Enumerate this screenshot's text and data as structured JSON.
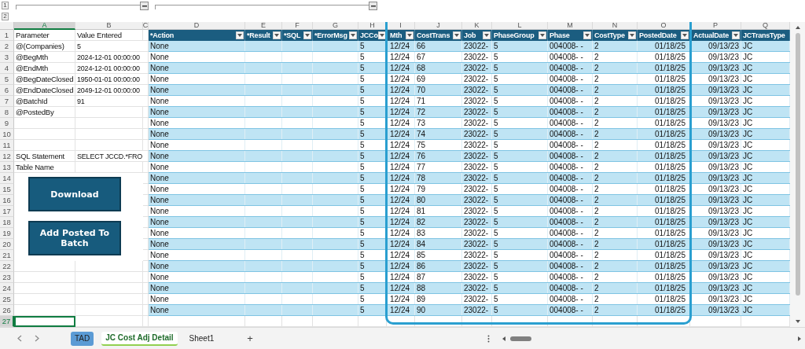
{
  "outline": {
    "levels": [
      "1",
      "2"
    ]
  },
  "column_letters": [
    {
      "letter": "A",
      "selected": true
    },
    {
      "letter": "B",
      "selected": false
    },
    {
      "letter": "C",
      "selected": false
    },
    {
      "letter": "D",
      "selected": false
    },
    {
      "letter": "E",
      "selected": false
    },
    {
      "letter": "F",
      "selected": false
    },
    {
      "letter": "G",
      "selected": false
    },
    {
      "letter": "H",
      "selected": false
    },
    {
      "letter": "I",
      "selected": false
    },
    {
      "letter": "J",
      "selected": false
    },
    {
      "letter": "K",
      "selected": false
    },
    {
      "letter": "L",
      "selected": false
    },
    {
      "letter": "M",
      "selected": false
    },
    {
      "letter": "N",
      "selected": false
    },
    {
      "letter": "O",
      "selected": false
    },
    {
      "letter": "P",
      "selected": false
    },
    {
      "letter": "Q",
      "selected": false
    }
  ],
  "row_numbers": [
    {
      "label": "1",
      "selected": false
    },
    {
      "label": "2",
      "selected": false
    },
    {
      "label": "3",
      "selected": false
    },
    {
      "label": "4",
      "selected": false
    },
    {
      "label": "5",
      "selected": false
    },
    {
      "label": "6",
      "selected": false
    },
    {
      "label": "7",
      "selected": false
    },
    {
      "label": "8",
      "selected": false
    },
    {
      "label": "9",
      "selected": false
    },
    {
      "label": "10",
      "selected": false
    },
    {
      "label": "11",
      "selected": false
    },
    {
      "label": "12",
      "selected": false
    },
    {
      "label": "13",
      "selected": false
    },
    {
      "label": "14",
      "selected": false
    },
    {
      "label": "15",
      "selected": false
    },
    {
      "label": "16",
      "selected": false
    },
    {
      "label": "17",
      "selected": false
    },
    {
      "label": "18",
      "selected": false
    },
    {
      "label": "19",
      "selected": false
    },
    {
      "label": "20",
      "selected": false
    },
    {
      "label": "21",
      "selected": false
    },
    {
      "label": "22",
      "selected": false
    },
    {
      "label": "23",
      "selected": false
    },
    {
      "label": "24",
      "selected": false
    },
    {
      "label": "25",
      "selected": false
    },
    {
      "label": "26",
      "selected": false
    },
    {
      "label": "27",
      "selected": true
    }
  ],
  "parameter_headings": [
    "Parameter",
    "Value Entered"
  ],
  "parameters": [
    {
      "name": "@(Companies)",
      "value": "5"
    },
    {
      "name": "@BegMth",
      "value": "2024-12-01 00:00:00"
    },
    {
      "name": "@EndMth",
      "value": "2024-12-01 00:00:00"
    },
    {
      "name": "@BegDateClosed",
      "value": "1950-01-01 00:00:00"
    },
    {
      "name": "@EndDateClosed",
      "value": "2049-12-01 00:00:00"
    },
    {
      "name": "@BatchId",
      "value": "91"
    },
    {
      "name": "@PostedBy"
    }
  ],
  "statements": [
    {
      "name": "SQL Statement",
      "value": "SELECT JCCD.*FRO"
    },
    {
      "name": "Table Name"
    }
  ],
  "buttons": [
    "Download",
    "Add Posted To Batch"
  ],
  "table": {
    "headers": [
      "*Action",
      "*Result",
      "*SQL",
      "*ErrorMsg",
      "JCCo",
      "Mth",
      "CostTrans",
      "Job",
      "PhaseGroup",
      "Phase",
      "CostType",
      "PostedDate",
      "ActualDate",
      "JCTransType"
    ],
    "rows": [
      {
        "action": "None",
        "values": [
          "5",
          "12/24",
          "66",
          "23022-",
          "5",
          "004008-  -",
          "2",
          "01/18/25",
          "09/13/23",
          "JC"
        ]
      },
      {
        "action": "None",
        "values": [
          "5",
          "12/24",
          "67",
          "23022-",
          "5",
          "004008-  -",
          "2",
          "01/18/25",
          "09/13/23",
          "JC"
        ]
      },
      {
        "action": "None",
        "values": [
          "5",
          "12/24",
          "68",
          "23022-",
          "5",
          "004008-  -",
          "2",
          "01/18/25",
          "09/13/23",
          "JC"
        ]
      },
      {
        "action": "None",
        "values": [
          "5",
          "12/24",
          "69",
          "23022-",
          "5",
          "004008-  -",
          "2",
          "01/18/25",
          "09/13/23",
          "JC"
        ]
      },
      {
        "action": "None",
        "values": [
          "5",
          "12/24",
          "70",
          "23022-",
          "5",
          "004008-  -",
          "2",
          "01/18/25",
          "09/13/23",
          "JC"
        ]
      },
      {
        "action": "None",
        "values": [
          "5",
          "12/24",
          "71",
          "23022-",
          "5",
          "004008-  -",
          "2",
          "01/18/25",
          "09/13/23",
          "JC"
        ]
      },
      {
        "action": "None",
        "values": [
          "5",
          "12/24",
          "72",
          "23022-",
          "5",
          "004008-  -",
          "2",
          "01/18/25",
          "09/13/23",
          "JC"
        ]
      },
      {
        "action": "None",
        "values": [
          "5",
          "12/24",
          "73",
          "23022-",
          "5",
          "004008-  -",
          "2",
          "01/18/25",
          "09/13/23",
          "JC"
        ]
      },
      {
        "action": "None",
        "values": [
          "5",
          "12/24",
          "74",
          "23022-",
          "5",
          "004008-  -",
          "2",
          "01/18/25",
          "09/13/23",
          "JC"
        ]
      },
      {
        "action": "None",
        "values": [
          "5",
          "12/24",
          "75",
          "23022-",
          "5",
          "004008-  -",
          "2",
          "01/18/25",
          "09/13/23",
          "JC"
        ]
      },
      {
        "action": "None",
        "values": [
          "5",
          "12/24",
          "76",
          "23022-",
          "5",
          "004008-  -",
          "2",
          "01/18/25",
          "09/13/23",
          "JC"
        ]
      },
      {
        "action": "None",
        "values": [
          "5",
          "12/24",
          "77",
          "23022-",
          "5",
          "004008-  -",
          "2",
          "01/18/25",
          "09/13/23",
          "JC"
        ]
      },
      {
        "action": "None",
        "values": [
          "5",
          "12/24",
          "78",
          "23022-",
          "5",
          "004008-  -",
          "2",
          "01/18/25",
          "09/13/23",
          "JC"
        ]
      },
      {
        "action": "None",
        "values": [
          "5",
          "12/24",
          "79",
          "23022-",
          "5",
          "004008-  -",
          "2",
          "01/18/25",
          "09/13/23",
          "JC"
        ]
      },
      {
        "action": "None",
        "values": [
          "5",
          "12/24",
          "80",
          "23022-",
          "5",
          "004008-  -",
          "2",
          "01/18/25",
          "09/13/23",
          "JC"
        ]
      },
      {
        "action": "None",
        "values": [
          "5",
          "12/24",
          "81",
          "23022-",
          "5",
          "004008-  -",
          "2",
          "01/18/25",
          "09/13/23",
          "JC"
        ]
      },
      {
        "action": "None",
        "values": [
          "5",
          "12/24",
          "82",
          "23022-",
          "5",
          "004008-  -",
          "2",
          "01/18/25",
          "09/13/23",
          "JC"
        ]
      },
      {
        "action": "None",
        "values": [
          "5",
          "12/24",
          "83",
          "23022-",
          "5",
          "004008-  -",
          "2",
          "01/18/25",
          "09/13/23",
          "JC"
        ]
      },
      {
        "action": "None",
        "values": [
          "5",
          "12/24",
          "84",
          "23022-",
          "5",
          "004008-  -",
          "2",
          "01/18/25",
          "09/13/23",
          "JC"
        ]
      },
      {
        "action": "None",
        "values": [
          "5",
          "12/24",
          "85",
          "23022-",
          "5",
          "004008-  -",
          "2",
          "01/18/25",
          "09/13/23",
          "JC"
        ]
      },
      {
        "action": "None",
        "values": [
          "5",
          "12/24",
          "86",
          "23022-",
          "5",
          "004008-  -",
          "2",
          "01/18/25",
          "09/13/23",
          "JC"
        ]
      },
      {
        "action": "None",
        "values": [
          "5",
          "12/24",
          "87",
          "23022-",
          "5",
          "004008-  -",
          "2",
          "01/18/25",
          "09/13/23",
          "JC"
        ]
      },
      {
        "action": "None",
        "values": [
          "5",
          "12/24",
          "88",
          "23022-",
          "5",
          "004008-  -",
          "2",
          "01/18/25",
          "09/13/23",
          "JC"
        ]
      },
      {
        "action": "None",
        "values": [
          "5",
          "12/24",
          "89",
          "23022-",
          "5",
          "004008-  -",
          "2",
          "01/18/25",
          "09/13/23",
          "JC"
        ]
      },
      {
        "action": "None",
        "values": [
          "5",
          "12/24",
          "90",
          "23022-",
          "5",
          "004008-  -",
          "2",
          "01/18/25",
          "09/13/23",
          "JC"
        ]
      }
    ]
  },
  "sheet_tabs": [
    {
      "label": "TAD",
      "selected": false,
      "color": "#5b9bd5"
    },
    {
      "label": "JC Cost Adj Detail",
      "selected": true,
      "color": "#92d050"
    },
    {
      "label": "Sheet1",
      "selected": false
    }
  ],
  "new_sheet": "+"
}
